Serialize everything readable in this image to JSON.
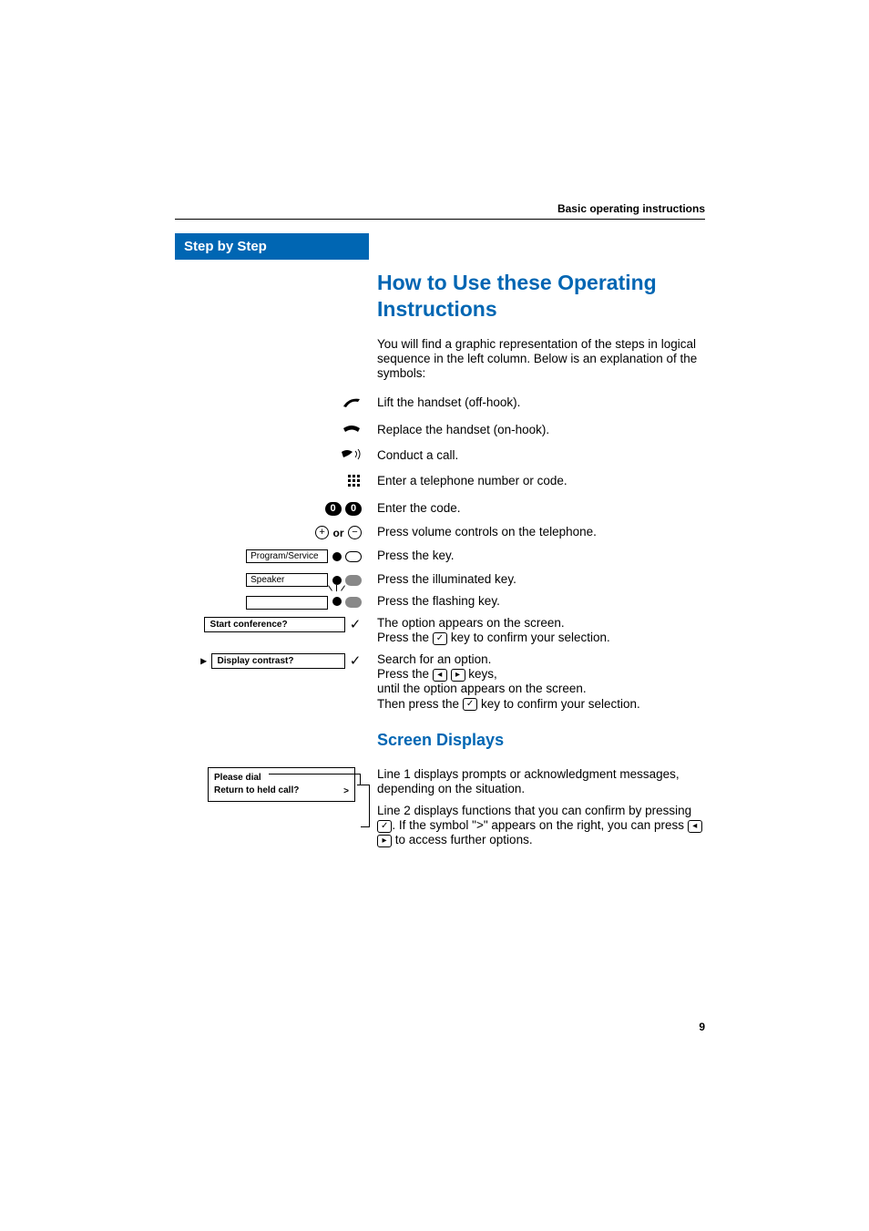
{
  "header": {
    "right": "Basic operating instructions"
  },
  "sidebar": {
    "step_header": "Step by Step"
  },
  "title": "How to Use these Operating Instructions",
  "intro": "You will find a graphic representation of the steps in logical sequence in the left column. Below is an explanation of the symbols:",
  "symbols": {
    "lift": "Lift the handset (off-hook).",
    "replace": "Replace the handset (on-hook).",
    "conduct": "Conduct a call.",
    "enter_number": "Enter a telephone number or code.",
    "enter_code": "Enter the code.",
    "volume": "Press volume controls on the telephone.",
    "press_key": "Press the key.",
    "press_illum": "Press the illuminated key.",
    "press_flash": "Press the flashing key.",
    "option_line1": "The option appears on the screen.",
    "option_line2_a": "Press the ",
    "option_line2_b": " key to confirm your selection.",
    "search_line1": "Search for an option.",
    "search_line2_a": "Press the ",
    "search_line2_b": " keys,",
    "search_line3": "until the option appears on the screen.",
    "search_line4_a": "Then press the ",
    "search_line4_b": " key to confirm your selection."
  },
  "labels": {
    "program_service": "Program/Service",
    "speaker": "Speaker",
    "start_conf": "Start conference?",
    "display_contrast": "Display contrast?",
    "or": "or",
    "zero": "0",
    "plus": "+",
    "minus": "−",
    "check": "✓",
    "left": "◂",
    "right": "▸",
    "caret": "▸",
    "gt": ">"
  },
  "screen_displays": {
    "heading": "Screen Displays",
    "box_line1": "Please dial",
    "box_line2": "Return to held call?",
    "p1": "Line 1 displays prompts or acknowledgment messages, depending on the situation.",
    "p2_a": "Line 2 displays functions that you can confirm by pressing ",
    "p2_b": ". If the symbol \">\" appears on the right, you can press ",
    "p2_c": " to access further options."
  },
  "page_number": "9"
}
